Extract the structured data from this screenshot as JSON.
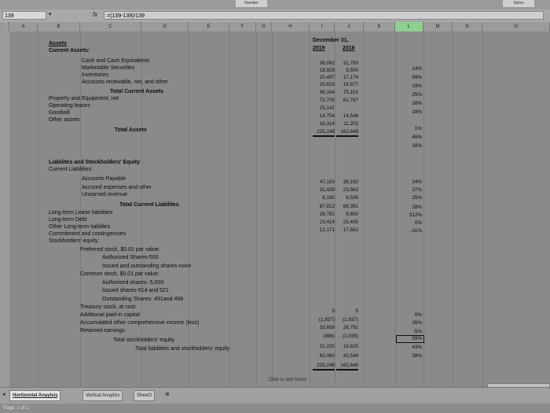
{
  "ribbon": {
    "tab_a": "Number",
    "tab_b": "Styles",
    "row_count": "139"
  },
  "formula_bar": {
    "cell_ref": "139",
    "fx": "fx",
    "formula": "=(139-139)/139"
  },
  "columns": [
    "A",
    "B",
    "C",
    "D",
    "E",
    "F",
    "G",
    "H",
    "I",
    "J",
    "K",
    "L",
    "M",
    "N",
    "O"
  ],
  "header": {
    "date_label": "December 31,",
    "year1": "2019",
    "year2": "2018"
  },
  "assets": {
    "title": "Assets",
    "current_title": "Current Assets:",
    "rows": [
      {
        "label": "Cash and Cash Equivalents",
        "y2019": "36,092",
        "y2018": "31,750",
        "pct": "14%"
      },
      {
        "label": "Marketable Securities",
        "y2019": "18,929",
        "y2018": "9,500",
        "pct": "99%"
      },
      {
        "label": "Inventories",
        "y2019": "20,497",
        "y2018": "17,174",
        "pct": "19%"
      },
      {
        "label": "Accounts receivable, net, and other",
        "y2019": "20,816",
        "y2018": "16,677",
        "pct": "25%"
      }
    ],
    "total_current": {
      "label": "Total Current Assets",
      "y2019": "96,334",
      "y2018": "75,101",
      "pct": "28%"
    },
    "ppe": {
      "label": "Property and Equipment, net",
      "y2019": "72,705",
      "y2018": "61,797",
      "pct": "18%"
    },
    "operating_leases": {
      "label": "Operating leases",
      "y2019": "25,141",
      "y2018": "",
      "pct": ""
    },
    "goodwill": {
      "label": "Goodwill",
      "y2019": "14,754",
      "y2018": "14,548",
      "pct": "1%"
    },
    "other": {
      "label": "Other assets",
      "y2019": "16,314",
      "y2018": "11,202",
      "pct": "46%"
    },
    "total": {
      "label": "Total Assets",
      "y2019": "225,248",
      "y2018": "162,648",
      "pct": "38%"
    }
  },
  "liabilities": {
    "title": "Liabilites and Stockholders' Equity",
    "current_title": "Current Liabilities:",
    "rows": [
      {
        "label": "Accounts Payable",
        "y2019": "47,183",
        "y2018": "38,192",
        "pct": "24%"
      },
      {
        "label": "Accured expenses and other",
        "y2019": "32,439",
        "y2018": "23,663",
        "pct": "37%"
      },
      {
        "label": "Unearned revenue",
        "y2019": "8,190",
        "y2018": "6,536",
        "pct": "25%"
      }
    ],
    "total_current": {
      "label": "Total Current Liabilites",
      "y2019": "87,812",
      "y2018": "68,391",
      "pct": "28%"
    },
    "lease": {
      "label": "Long-term Lease liabilities",
      "y2019": "39,791",
      "y2018": "9,650",
      "pct": "312%"
    },
    "debt": {
      "label": "Long-term Debt",
      "y2019": "23,414",
      "y2018": "23,495",
      "pct": "0%"
    },
    "other": {
      "label": "Other Long-term liabilites",
      "y2019": "12,171",
      "y2018": "17,563",
      "pct": "-31%"
    },
    "commitments": "Commitment and contingencies"
  },
  "equity": {
    "title": "Stockholders' equity:",
    "preferred": "Preferred stock, $0.01 par value:",
    "pref_auth": "Authorized Shares-500",
    "pref_issued": "Issued and outstanding shares-none",
    "common": "Common stock, $0.01 par value:",
    "common_auth": "Authorized shares- 5,000",
    "common_issued": "Issued shares-514 and 521",
    "common_out": {
      "label": "Outstanding Shares- 491and 498",
      "y2019": "5",
      "y2018": "5",
      "pct": "0%"
    },
    "treasury": {
      "label": "Treasury stock, at cost",
      "y2019": "(1,837)",
      "y2018": "(1,837)",
      "pct": "26%"
    },
    "apic": {
      "label": "Additional paid-in capital",
      "y2019": "33,658",
      "y2018": "26,791",
      "pct": "-5%"
    },
    "aoci": {
      "label": "Accumulated other comprehensive income (less)",
      "y2019": "(986)",
      "y2018": "(1,035)",
      "pct": "59%"
    },
    "retained": {
      "label": "Retained earnings",
      "y2019": "31,220",
      "y2018": "19,625",
      "pct": "43%"
    },
    "total_se": {
      "label": "Total stockholders' equity",
      "y2019": "62,060",
      "y2018": "43,549",
      "pct": "38%"
    },
    "total_lse": {
      "label": "Total liabilities and stockholders' equity",
      "y2019": "225,248",
      "y2018": "162,648",
      "pct": ""
    }
  },
  "footer_hint": "Click to add footer",
  "tabs": [
    "Hortizontal Anaylsis",
    "Vertical Anaylsis",
    "Sheet3"
  ],
  "status": "Page: 1 of 1"
}
